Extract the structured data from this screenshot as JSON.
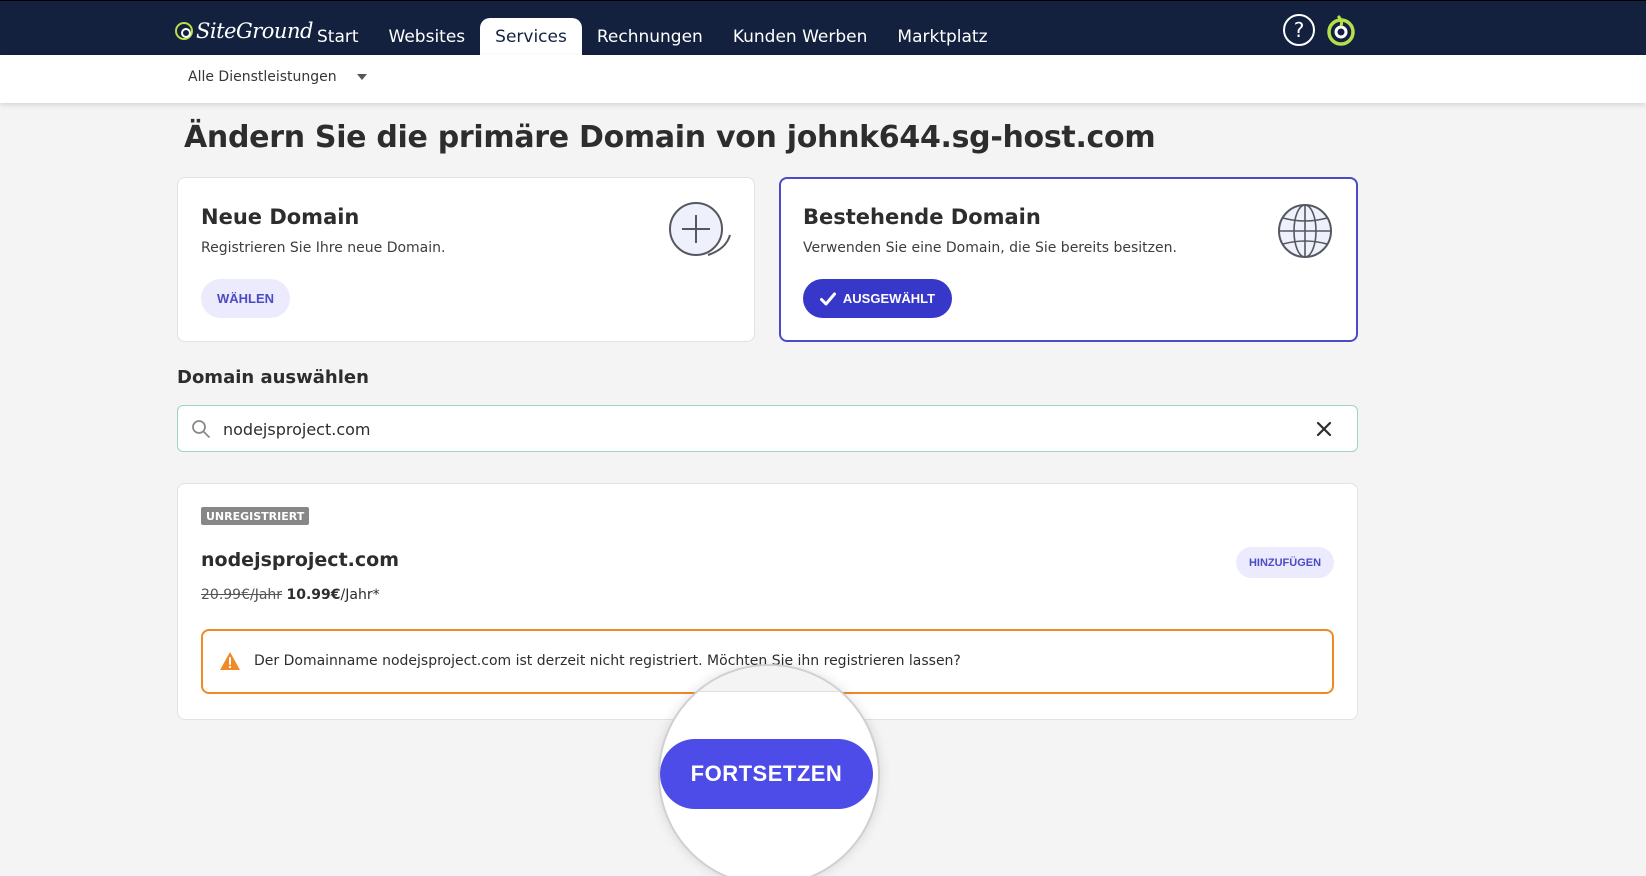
{
  "header": {
    "logo_text": "SiteGround",
    "nav": [
      {
        "label": "Start"
      },
      {
        "label": "Websites"
      },
      {
        "label": "Services"
      },
      {
        "label": "Rechnungen"
      },
      {
        "label": "Kunden Werben"
      },
      {
        "label": "Marktplatz"
      }
    ],
    "active_tab": "Services",
    "help_icon_glyph": "?"
  },
  "subnav": {
    "dropdown_label": "Alle Dienstleistungen"
  },
  "page": {
    "title": "Ändern Sie die primäre Domain von johnk644.sg-host.com"
  },
  "options": {
    "new_domain": {
      "title": "Neue Domain",
      "description": "Registrieren Sie Ihre neue Domain.",
      "button": "WÄHLEN",
      "icon": "plus-circle-icon"
    },
    "existing_domain": {
      "title": "Bestehende Domain",
      "description": "Verwenden Sie eine Domain, die Sie bereits besitzen.",
      "button": "AUSGEWÄHLT",
      "icon": "globe-icon",
      "selected": true
    }
  },
  "domain_select": {
    "label": "Domain auswählen",
    "search_value": "nodejsproject.com"
  },
  "result": {
    "badge": "UNREGISTRIERT",
    "domain": "nodejsproject.com",
    "price_old": "20.99€/Jahr",
    "price_new": "10.99€",
    "price_suffix": "/Jahr*",
    "add_button": "HINZUFÜGEN",
    "warning": "Der Domainname nodejsproject.com ist derzeit nicht registriert. Möchten Sie ihn registrieren lassen?"
  },
  "actions": {
    "continue_button": "FORTSETZEN"
  },
  "colors": {
    "header_bg": "#13213f",
    "primary": "#3738c9",
    "continue": "#4d4ce8",
    "warning_border": "#f08a24",
    "brand_green": "#b6e04a"
  }
}
